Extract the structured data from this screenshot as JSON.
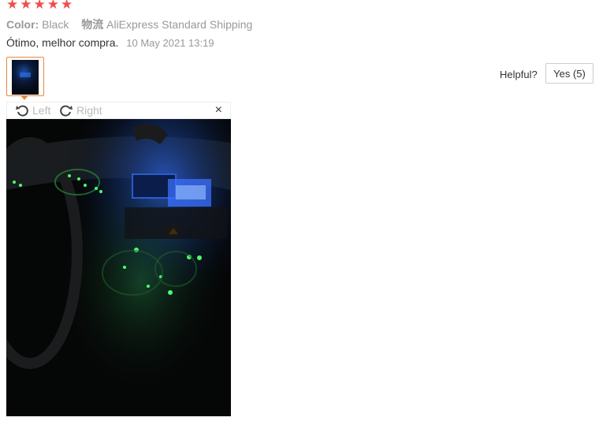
{
  "review": {
    "rating": 5,
    "star_glyph": "★",
    "color_label": "Color:",
    "color_value": "Black",
    "shipping_label": "物流",
    "shipping_value": "AliExpress Standard Shipping",
    "text": "Ótimo, melhor compra.",
    "date": "10 May 2021 13:19"
  },
  "helpful": {
    "label": "Helpful?",
    "yes_button": "Yes (5)"
  },
  "viewer": {
    "rotate_left": "Left",
    "rotate_right": "Right",
    "close": "×"
  },
  "colors": {
    "star": "#f04c4c",
    "thumb_border": "#e8883a"
  }
}
